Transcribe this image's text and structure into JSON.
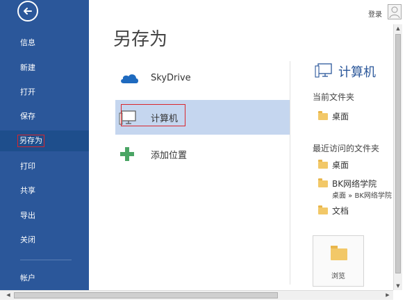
{
  "app": {
    "login_label": "登录"
  },
  "sidebar": {
    "items": [
      {
        "label": "信息"
      },
      {
        "label": "新建"
      },
      {
        "label": "打开"
      },
      {
        "label": "保存"
      },
      {
        "label": "另存为",
        "active": true
      },
      {
        "label": "打印"
      },
      {
        "label": "共享"
      },
      {
        "label": "导出"
      },
      {
        "label": "关闭"
      },
      {
        "label": "帐户"
      }
    ],
    "colors": {
      "background": "#2b579a",
      "active": "#1e4e8c",
      "highlight_border": "#d9262c"
    }
  },
  "main": {
    "title": "另存为",
    "locations": [
      {
        "label": "SkyDrive",
        "icon": "cloud-icon"
      },
      {
        "label": "计算机",
        "icon": "computer-icon",
        "selected": true
      },
      {
        "label": "添加位置",
        "icon": "plus-icon"
      }
    ]
  },
  "right_panel": {
    "title": "计算机",
    "current_folder_heading": "当前文件夹",
    "current_folders": [
      {
        "label": "桌面"
      }
    ],
    "recent_heading": "最近访问的文件夹",
    "recent_folders": [
      {
        "label": "桌面"
      },
      {
        "label": "BK网络学院",
        "subpath": "桌面 » BK网络学院"
      },
      {
        "label": "文档"
      }
    ],
    "browse_label": "浏览"
  }
}
